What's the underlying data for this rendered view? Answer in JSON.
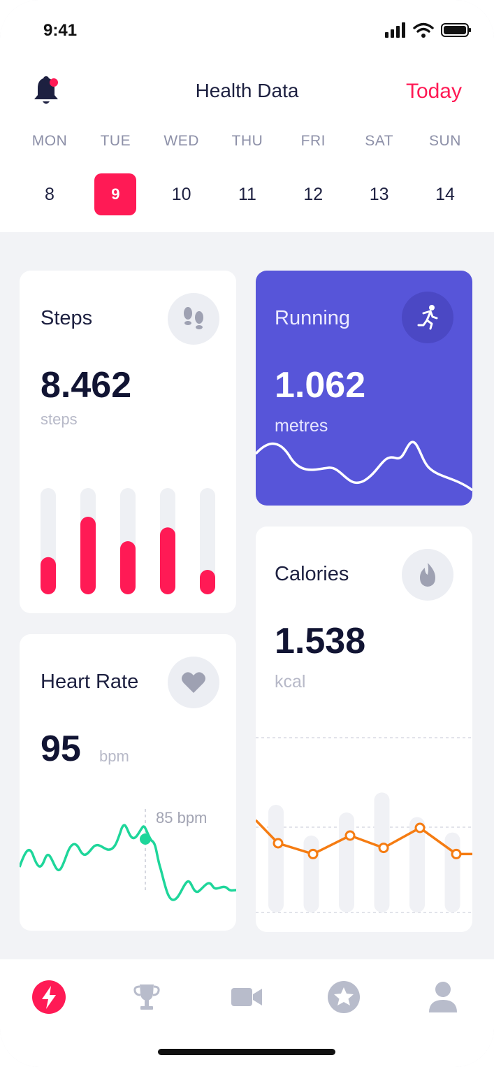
{
  "status_bar": {
    "time": "9:41"
  },
  "header": {
    "title": "Health Data",
    "today_label": "Today"
  },
  "week": [
    {
      "name": "MON",
      "num": "8"
    },
    {
      "name": "TUE",
      "num": "9",
      "active": true
    },
    {
      "name": "WED",
      "num": "10"
    },
    {
      "name": "THU",
      "num": "11"
    },
    {
      "name": "FRI",
      "num": "12"
    },
    {
      "name": "SAT",
      "num": "13"
    },
    {
      "name": "SUN",
      "num": "14"
    }
  ],
  "steps": {
    "title": "Steps",
    "value": "8.462",
    "unit": "steps",
    "icon": "footprints-icon",
    "bars": [
      0.35,
      0.73,
      0.5,
      0.63,
      0.23
    ]
  },
  "running": {
    "title": "Running",
    "value": "1.062",
    "unit": "metres",
    "icon": "running-icon"
  },
  "heart": {
    "title": "Heart Rate",
    "value": "95",
    "unit": "bpm",
    "icon": "heart-icon",
    "marker_label": "85 bpm"
  },
  "calories": {
    "title": "Calories",
    "value": "1.538",
    "unit": "kcal",
    "icon": "flame-icon",
    "bar_levels": [
      0.7,
      0.5,
      0.65,
      0.78,
      0.62,
      0.52
    ],
    "line_points": [
      0.6,
      0.45,
      0.38,
      0.5,
      0.42,
      0.55,
      0.38,
      0.38
    ]
  },
  "nav": [
    {
      "icon": "lightning-icon",
      "active": true
    },
    {
      "icon": "trophy-icon"
    },
    {
      "icon": "video-icon"
    },
    {
      "icon": "star-icon"
    },
    {
      "icon": "profile-icon"
    }
  ],
  "colors": {
    "accent": "#ff1a55",
    "running_bg": "#5755d9",
    "heart_line": "#1ed69a",
    "calories_line": "#f57c12",
    "inactive_icon": "#b8bccb"
  }
}
